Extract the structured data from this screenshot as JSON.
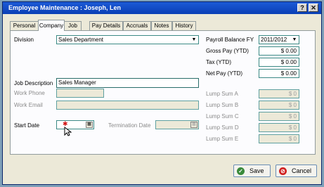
{
  "window": {
    "title": "Employee Maintenance : Joseph, Len"
  },
  "tabs": [
    "Personal",
    "Company",
    "Job",
    "Pay Details",
    "Accruals",
    "Notes",
    "History"
  ],
  "active_tab": "Company",
  "form": {
    "division_label": "Division",
    "division_value": "Sales Department",
    "job_description_label": "Job Description",
    "job_description_value": "Sales Manager",
    "work_phone_label": "Work Phone",
    "work_email_label": "Work Email",
    "start_date_label": "Start Date",
    "termination_date_label": "Termination Date"
  },
  "payroll": {
    "balance_fy_label": "Payroll Balance FY",
    "balance_fy_value": "2011/2012",
    "gross_pay_label": "Gross Pay (YTD)",
    "gross_pay_value": "$ 0.00",
    "tax_label": "Tax (YTD)",
    "tax_value": "$ 0.00",
    "net_pay_label": "Net Pay (YTD)",
    "net_pay_value": "$ 0.00",
    "lump_sum_a_label": "Lump Sum A",
    "lump_sum_a_value": "$ 0",
    "lump_sum_b_label": "Lump Sum B",
    "lump_sum_b_value": "$ 0",
    "lump_sum_c_label": "Lump Sum C",
    "lump_sum_c_value": "$ 0",
    "lump_sum_d_label": "Lump Sum D",
    "lump_sum_d_value": "$ 0",
    "lump_sum_e_label": "Lump Sum E",
    "lump_sum_e_value": "$ 0"
  },
  "buttons": {
    "save_label": "Save",
    "cancel_label": "Cancel"
  },
  "colors": {
    "titlebar": "#0a3fb5",
    "field_border": "#3c8a86",
    "cancel_icon": "#d02020",
    "save_icon": "#3a8a3a"
  }
}
